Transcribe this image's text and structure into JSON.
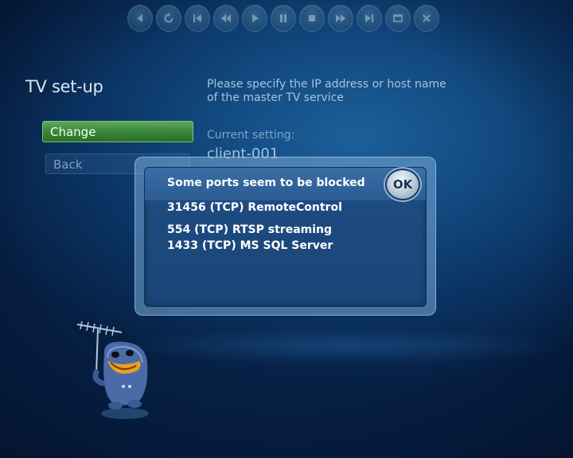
{
  "transport": {
    "buttons": [
      {
        "icon": "back-arrow-icon"
      },
      {
        "icon": "refresh-icon"
      },
      {
        "icon": "skip-back-icon"
      },
      {
        "icon": "rewind-icon"
      },
      {
        "icon": "play-icon"
      },
      {
        "icon": "pause-icon"
      },
      {
        "icon": "stop-icon"
      },
      {
        "icon": "fast-forward-icon"
      },
      {
        "icon": "skip-forward-icon"
      },
      {
        "icon": "window-icon"
      },
      {
        "icon": "close-icon"
      }
    ]
  },
  "page": {
    "title": "TV set-up",
    "instruction_line1": "Please specify the IP address or host name",
    "instruction_line2": "of the master TV service",
    "current_setting_label": "Current setting:",
    "current_setting_value": "client-001"
  },
  "sidebar": {
    "change_label": "Change",
    "back_label": "Back"
  },
  "dialog": {
    "title": "Some ports seem to be blocked",
    "ok_label": "OK",
    "ports": [
      "31456 (TCP) RemoteControl",
      "554 (TCP) RTSP streaming",
      "1433 (TCP) MS SQL Server"
    ]
  },
  "colors": {
    "background": "#124a80",
    "accent_green": "#3d8a3a",
    "dialog_fill": "#1f4d82"
  }
}
